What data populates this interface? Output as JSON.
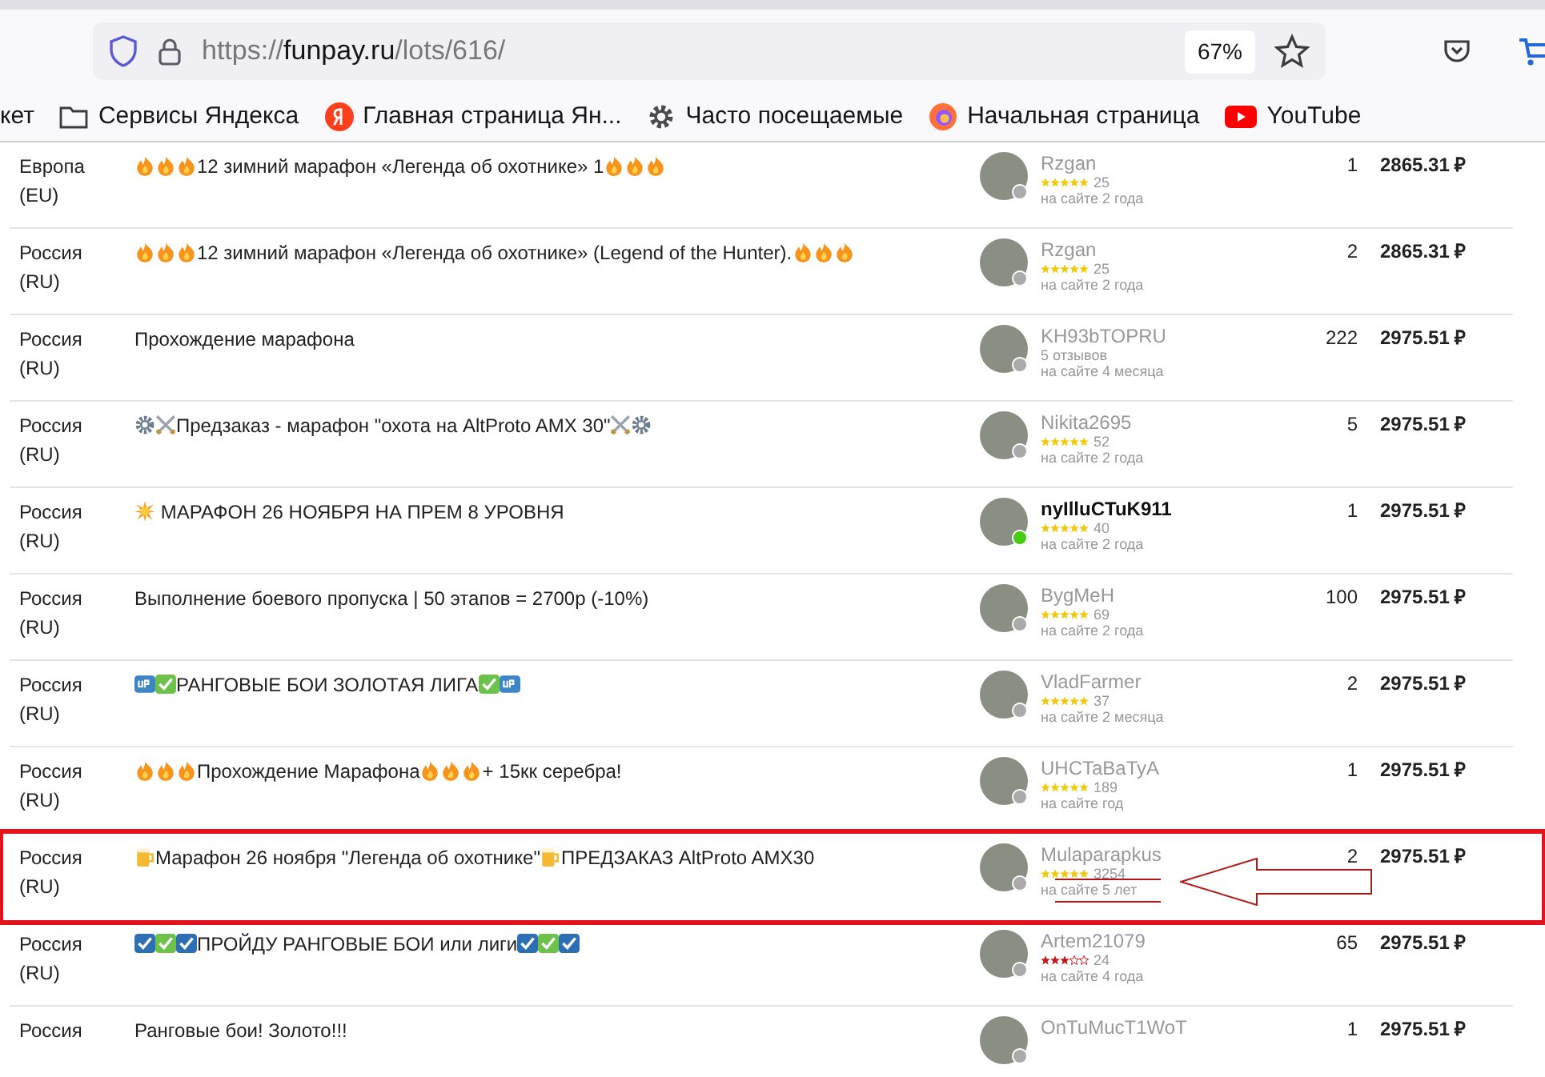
{
  "browser": {
    "url": {
      "scheme": "https://",
      "host": "funpay.ru",
      "path": "/lots/616/"
    },
    "zoom": "67%",
    "bookmarks": [
      {
        "kind": "cut",
        "label": "кет"
      },
      {
        "kind": "folder",
        "label": "Сервисы Яндекса"
      },
      {
        "kind": "yandex",
        "label": "Главная страница Ян..."
      },
      {
        "kind": "gear",
        "label": "Часто посещаемые"
      },
      {
        "kind": "firefox",
        "label": "Начальная страница"
      },
      {
        "kind": "youtube",
        "label": "YouTube"
      }
    ]
  },
  "offers": [
    {
      "region": [
        "Европа",
        "(EU)"
      ],
      "title": [
        {
          "kind": "fire"
        },
        {
          "kind": "fire"
        },
        {
          "kind": "fire"
        },
        {
          "kind": "text",
          "text": "12 зимний марафон «Легенда об охотнике» 1"
        },
        {
          "kind": "fire"
        },
        {
          "kind": "fire"
        },
        {
          "kind": "fire"
        }
      ],
      "seller": {
        "name": "Rzgan",
        "online": false,
        "stars": 5,
        "reviews": "25",
        "since": "на сайте 2 года"
      },
      "count": "1",
      "price": "2865.31 ₽",
      "highlighted": false
    },
    {
      "region": [
        "Россия",
        "(RU)"
      ],
      "title": [
        {
          "kind": "fire"
        },
        {
          "kind": "fire"
        },
        {
          "kind": "fire"
        },
        {
          "kind": "text",
          "text": "12 зимний марафон «Легенда об охотнике» (Legend of the Hunter)."
        },
        {
          "kind": "fire"
        },
        {
          "kind": "fire"
        },
        {
          "kind": "fire"
        }
      ],
      "seller": {
        "name": "Rzgan",
        "online": false,
        "stars": 5,
        "reviews": "25",
        "since": "на сайте 2 года"
      },
      "count": "2",
      "price": "2865.31 ₽",
      "highlighted": false
    },
    {
      "region": [
        "Россия",
        "(RU)"
      ],
      "title": [
        {
          "kind": "text",
          "text": "Прохождение марафона"
        }
      ],
      "seller": {
        "name": "KH93bTOPRU",
        "online": false,
        "reviews": "5 отзывов",
        "since": "на сайте 4 месяца"
      },
      "count": "222",
      "price": "2975.51 ₽",
      "highlighted": false
    },
    {
      "region": [
        "Россия",
        "(RU)"
      ],
      "title": [
        {
          "kind": "gear"
        },
        {
          "kind": "swords"
        },
        {
          "kind": "text",
          "text": "Предзаказ - марафон \"охота на AltProto AMX 30\""
        },
        {
          "kind": "swords"
        },
        {
          "kind": "gear"
        }
      ],
      "seller": {
        "name": "Nikita2695",
        "online": false,
        "stars": 5,
        "reviews": "52",
        "since": "на сайте 2 года"
      },
      "count": "5",
      "price": "2975.51 ₽",
      "highlighted": false
    },
    {
      "region": [
        "Россия",
        "(RU)"
      ],
      "title": [
        {
          "kind": "sun"
        },
        {
          "kind": "text",
          "text": " МАРАФОН 26 НОЯБРЯ НА ПРЕМ 8 УРОВНЯ"
        }
      ],
      "seller": {
        "name": "nyIlluCTuK911",
        "online": true,
        "stars": 5,
        "reviews": "40",
        "since": "на сайте 2 года"
      },
      "count": "1",
      "price": "2975.51 ₽",
      "highlighted": false
    },
    {
      "region": [
        "Россия",
        "(RU)"
      ],
      "title": [
        {
          "kind": "text",
          "text": "Выполнение боевого пропуска | 50 этапов = 2700р (-10%)"
        }
      ],
      "seller": {
        "name": "BygMeH",
        "online": false,
        "stars": 5,
        "reviews": "69",
        "since": "на сайте 2 года"
      },
      "count": "100",
      "price": "2975.51 ₽",
      "highlighted": false
    },
    {
      "region": [
        "Россия",
        "(RU)"
      ],
      "title": [
        {
          "kind": "up"
        },
        {
          "kind": "check"
        },
        {
          "kind": "text",
          "text": "РАНГОВЫЕ БОИ ЗОЛОТАЯ ЛИГА"
        },
        {
          "kind": "check"
        },
        {
          "kind": "up"
        }
      ],
      "seller": {
        "name": "VladFarmer",
        "online": false,
        "stars": 5,
        "reviews": "37",
        "since": "на сайте 2 месяца"
      },
      "count": "2",
      "price": "2975.51 ₽",
      "highlighted": false
    },
    {
      "region": [
        "Россия",
        "(RU)"
      ],
      "title": [
        {
          "kind": "fire"
        },
        {
          "kind": "fire"
        },
        {
          "kind": "fire"
        },
        {
          "kind": "text",
          "text": "Прохождение Марафона"
        },
        {
          "kind": "fire"
        },
        {
          "kind": "fire"
        },
        {
          "kind": "fire"
        },
        {
          "kind": "text",
          "text": "+ 15кк серебра!"
        }
      ],
      "seller": {
        "name": "UHCTaBaTyA",
        "online": false,
        "stars": 5,
        "reviews": "189",
        "since": "на сайте год"
      },
      "count": "1",
      "price": "2975.51 ₽",
      "highlighted": false
    },
    {
      "region": [
        "Россия",
        "(RU)"
      ],
      "title": [
        {
          "kind": "beer"
        },
        {
          "kind": "text",
          "text": "Марафон 26 ноября \"Легенда об охотнике\""
        },
        {
          "kind": "beer"
        },
        {
          "kind": "text",
          "text": "ПРЕДЗАКАЗ AltProto AMX30"
        }
      ],
      "seller": {
        "name": "Mulaparapkus",
        "online": false,
        "stars": 5,
        "reviews": "3254",
        "since": "на сайте 5 лет"
      },
      "count": "2",
      "price": "2975.51 ₽",
      "highlighted": true
    },
    {
      "region": [
        "Россия",
        "(RU)"
      ],
      "title": [
        {
          "kind": "boxcheck"
        },
        {
          "kind": "check"
        },
        {
          "kind": "boxcheck"
        },
        {
          "kind": "text",
          "text": "ПРОЙДУ РАНГОВЫЕ БОИ или лиги"
        },
        {
          "kind": "boxcheck"
        },
        {
          "kind": "check"
        },
        {
          "kind": "boxcheck"
        }
      ],
      "seller": {
        "name": "Artem21079",
        "online": false,
        "stars": 3,
        "reviews": "24",
        "since": "на сайте 4 года"
      },
      "count": "65",
      "price": "2975.51 ₽",
      "highlighted": false
    },
    {
      "region": [
        "Россия"
      ],
      "title": [
        {
          "kind": "text",
          "text": "Ранговые бои! Золото!!!"
        }
      ],
      "seller": {
        "name": "OnTuMucT1WoT",
        "online": false
      },
      "count": "1",
      "price": "2975.51 ₽",
      "highlighted": false
    }
  ]
}
